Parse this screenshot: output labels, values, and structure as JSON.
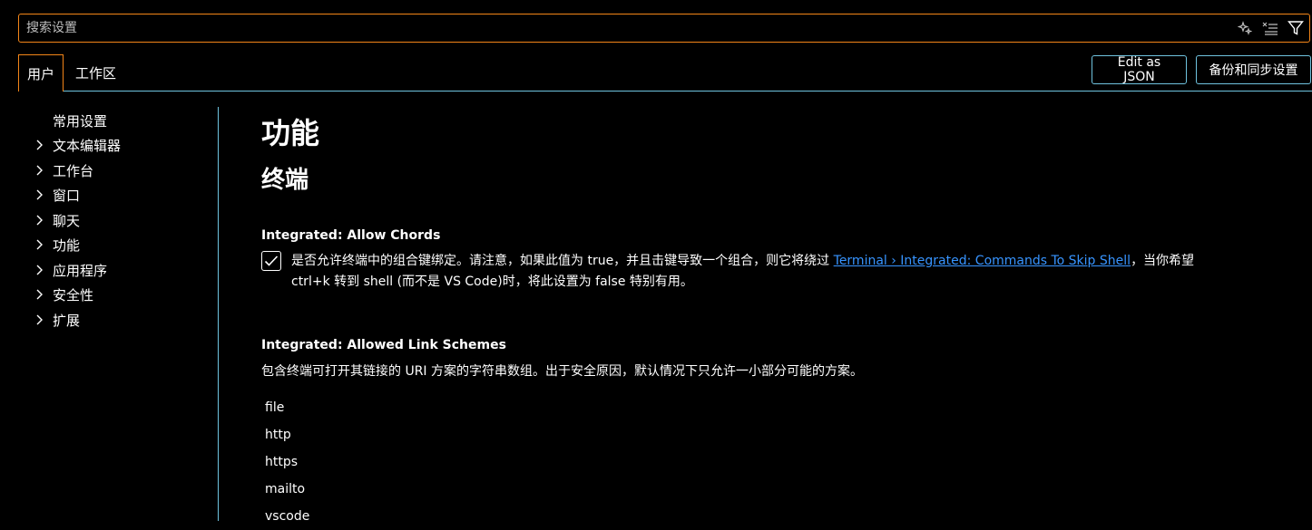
{
  "search": {
    "placeholder": "搜索设置",
    "value": "",
    "icons": [
      "sparkle-icon",
      "clear-filter-icon",
      "filter-icon"
    ]
  },
  "tabs": [
    {
      "label": "用户",
      "active": true
    },
    {
      "label": "工作区",
      "active": false
    }
  ],
  "header_buttons": {
    "edit_json": "Edit as JSON",
    "backup_sync": "备份和同步设置"
  },
  "toc": {
    "items": [
      {
        "label": "常用设置",
        "expandable": false
      },
      {
        "label": "文本编辑器",
        "expandable": true
      },
      {
        "label": "工作台",
        "expandable": true
      },
      {
        "label": "窗口",
        "expandable": true
      },
      {
        "label": "聊天",
        "expandable": true
      },
      {
        "label": "功能",
        "expandable": true
      },
      {
        "label": "应用程序",
        "expandable": true
      },
      {
        "label": "安全性",
        "expandable": true
      },
      {
        "label": "扩展",
        "expandable": true
      }
    ]
  },
  "content": {
    "section_title": "功能",
    "subsection_title": "终端",
    "settings": [
      {
        "title_prefix": "Integrated: ",
        "title": "Allow Chords",
        "checked": true,
        "desc_part1": "是否允许终端中的组合键绑定。请注意，如果此值为 true，并且击键导致一个组合，则它将绕过 ",
        "desc_link": "Terminal › Integrated: Commands To Skip Shell",
        "desc_part2": "，当你希望",
        "desc_line2": "ctrl+k 转到 shell (而不是 VS Code)时，将此设置为 false 特别有用。"
      },
      {
        "title_prefix": "Integrated: ",
        "title": "Allowed Link Schemes",
        "desc": "包含终端可打开其链接的 URI 方案的字符串数组。出于安全原因，默认情况下只允许一小部分可能的方案。",
        "items": [
          "file",
          "http",
          "https",
          "mailto",
          "vscode"
        ]
      }
    ]
  },
  "colors": {
    "focus_border": "#f38518",
    "contrast_border": "#6fc3df",
    "link": "#3794ff",
    "background": "#000000"
  }
}
